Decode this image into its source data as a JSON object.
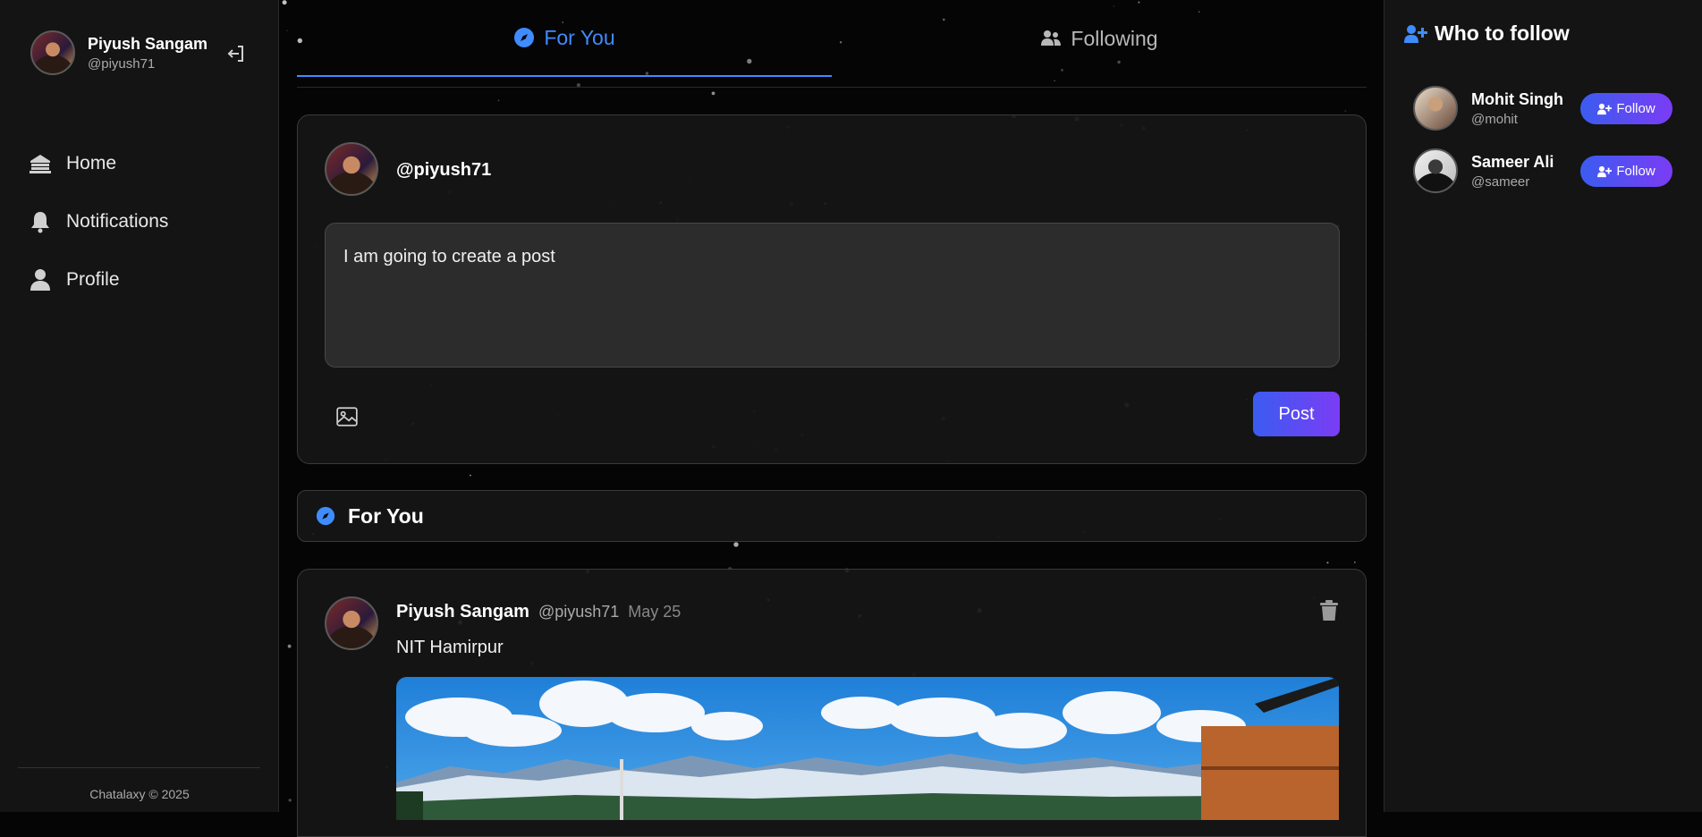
{
  "user": {
    "name": "Piyush Sangam",
    "handle": "@piyush71"
  },
  "nav": {
    "items": [
      {
        "label": "Home",
        "icon": "home-icon"
      },
      {
        "label": "Notifications",
        "icon": "bell-icon"
      },
      {
        "label": "Profile",
        "icon": "user-icon"
      }
    ]
  },
  "footer": "Chatalaxy © 2025",
  "tabs": [
    {
      "label": "For You",
      "icon": "compass-icon",
      "active": true
    },
    {
      "label": "Following",
      "icon": "users-icon",
      "active": false
    }
  ],
  "composer": {
    "handle": "@piyush71",
    "text": "I am going to create a post",
    "post_label": "Post"
  },
  "feed_title": "For You",
  "posts": [
    {
      "author": "Piyush Sangam",
      "handle": "@piyush71",
      "date": "May 25",
      "text": "NIT Hamirpur"
    }
  ],
  "who_to_follow": {
    "title": "Who to follow",
    "users": [
      {
        "name": "Mohit Singh",
        "handle": "@mohit",
        "button": "Follow"
      },
      {
        "name": "Sameer Ali",
        "handle": "@sameer",
        "button": "Follow"
      }
    ]
  },
  "colors": {
    "accent": "#3f8cff",
    "button_start": "#3b5cf0",
    "button_end": "#7b3cf5",
    "background": "#050505",
    "panel": "#141414"
  }
}
